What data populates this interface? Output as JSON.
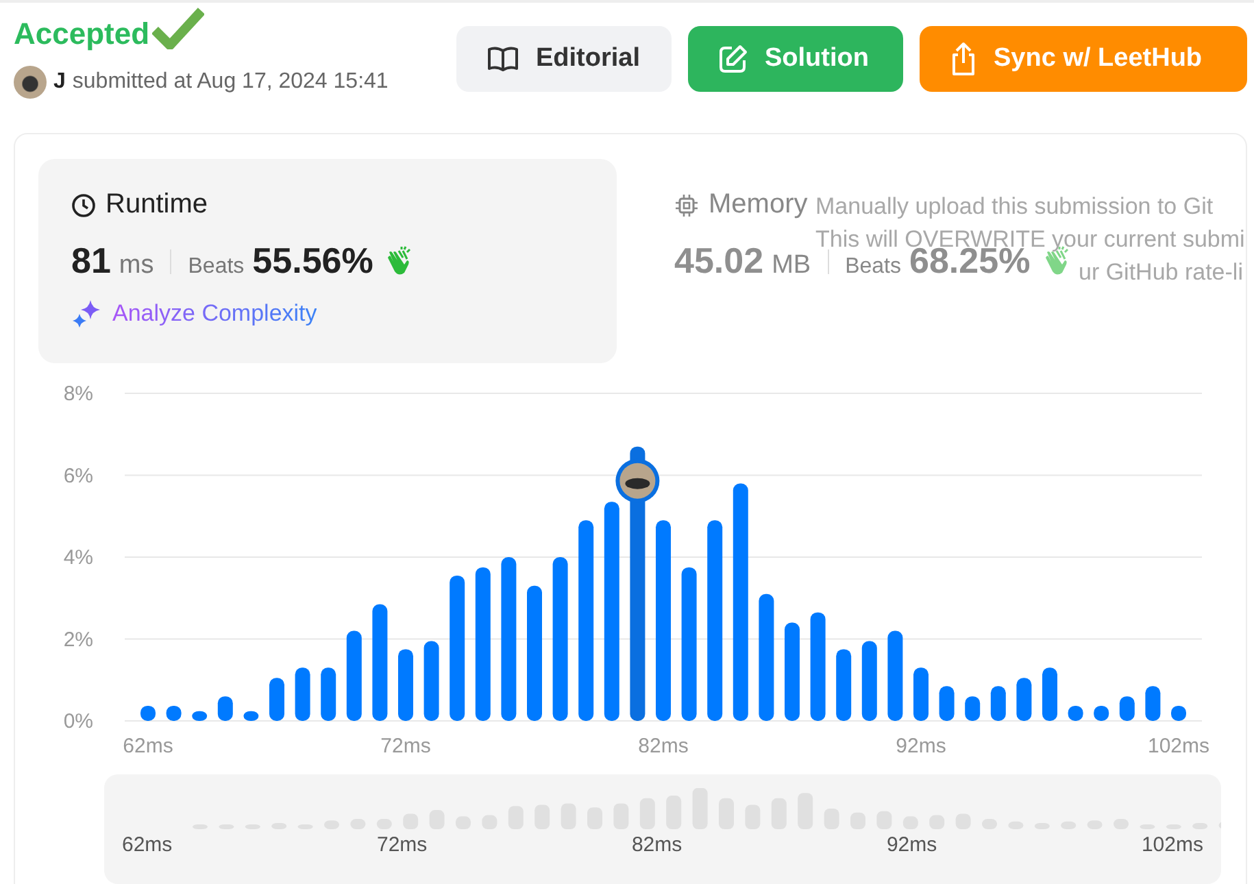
{
  "header": {
    "status": "Accepted",
    "user": "J",
    "submitted": "submitted at Aug 17, 2024 15:41"
  },
  "buttons": [
    {
      "label": "Editorial",
      "kind": "editorial"
    },
    {
      "label": "Solution",
      "kind": "solution"
    },
    {
      "label": "Sync w/ LeetHub",
      "kind": "sync"
    }
  ],
  "stats": [
    {
      "kind": "runtime",
      "title": "Runtime",
      "value": "81",
      "unit": "ms",
      "beats_label": "Beats",
      "beats": "55.56%",
      "selected": true,
      "action": "Analyze Complexity"
    },
    {
      "kind": "memory",
      "title": "Memory",
      "value": "45.02",
      "unit": "MB",
      "beats_label": "Beats",
      "beats": "68.25%",
      "selected": false
    }
  ],
  "tooltip": {
    "lines": [
      "Manually upload this submission to Git",
      "This will OVERWRITE your current submi",
      "ur GitHub rate-li"
    ]
  },
  "chart": {
    "chart_data": {
      "type": "bar",
      "grid": true,
      "x": [
        62,
        63,
        64,
        65,
        66,
        67,
        68,
        69,
        70,
        71,
        72,
        73,
        74,
        75,
        76,
        77,
        78,
        79,
        80,
        81,
        82,
        83,
        84,
        85,
        86,
        87,
        88,
        89,
        90,
        91,
        92,
        93,
        94,
        95,
        96,
        97,
        98,
        99,
        100,
        101,
        102
      ],
      "values": [
        0.37,
        0.37,
        0.24,
        0.6,
        0.24,
        1.05,
        1.3,
        1.3,
        2.2,
        2.85,
        1.75,
        1.95,
        3.55,
        3.75,
        4.0,
        3.3,
        4.0,
        4.9,
        5.35,
        6.7,
        4.9,
        3.75,
        4.9,
        5.8,
        3.1,
        2.4,
        2.65,
        1.75,
        1.95,
        2.2,
        1.3,
        0.85,
        0.6,
        0.85,
        1.05,
        1.3,
        0.37,
        0.37,
        0.6,
        0.85,
        0.37
      ],
      "xlim": [
        62,
        102
      ],
      "ylim": [
        0,
        8
      ],
      "yticks": [
        {
          "value": 0,
          "label": "0%"
        },
        {
          "value": 2,
          "label": "2%"
        },
        {
          "value": 4,
          "label": "4%"
        },
        {
          "value": 6,
          "label": "6%"
        },
        {
          "value": 8,
          "label": "8%"
        }
      ],
      "xticks": [
        {
          "value": 62,
          "label": "62ms"
        },
        {
          "value": 72,
          "label": "72ms"
        },
        {
          "value": 82,
          "label": "82ms"
        },
        {
          "value": 92,
          "label": "92ms"
        },
        {
          "value": 102,
          "label": "102ms"
        }
      ]
    },
    "marker": {
      "kind": "avatar"
    }
  },
  "navigator": {
    "labels": [
      "62ms",
      "72ms",
      "82ms",
      "92ms",
      "102ms"
    ]
  }
}
